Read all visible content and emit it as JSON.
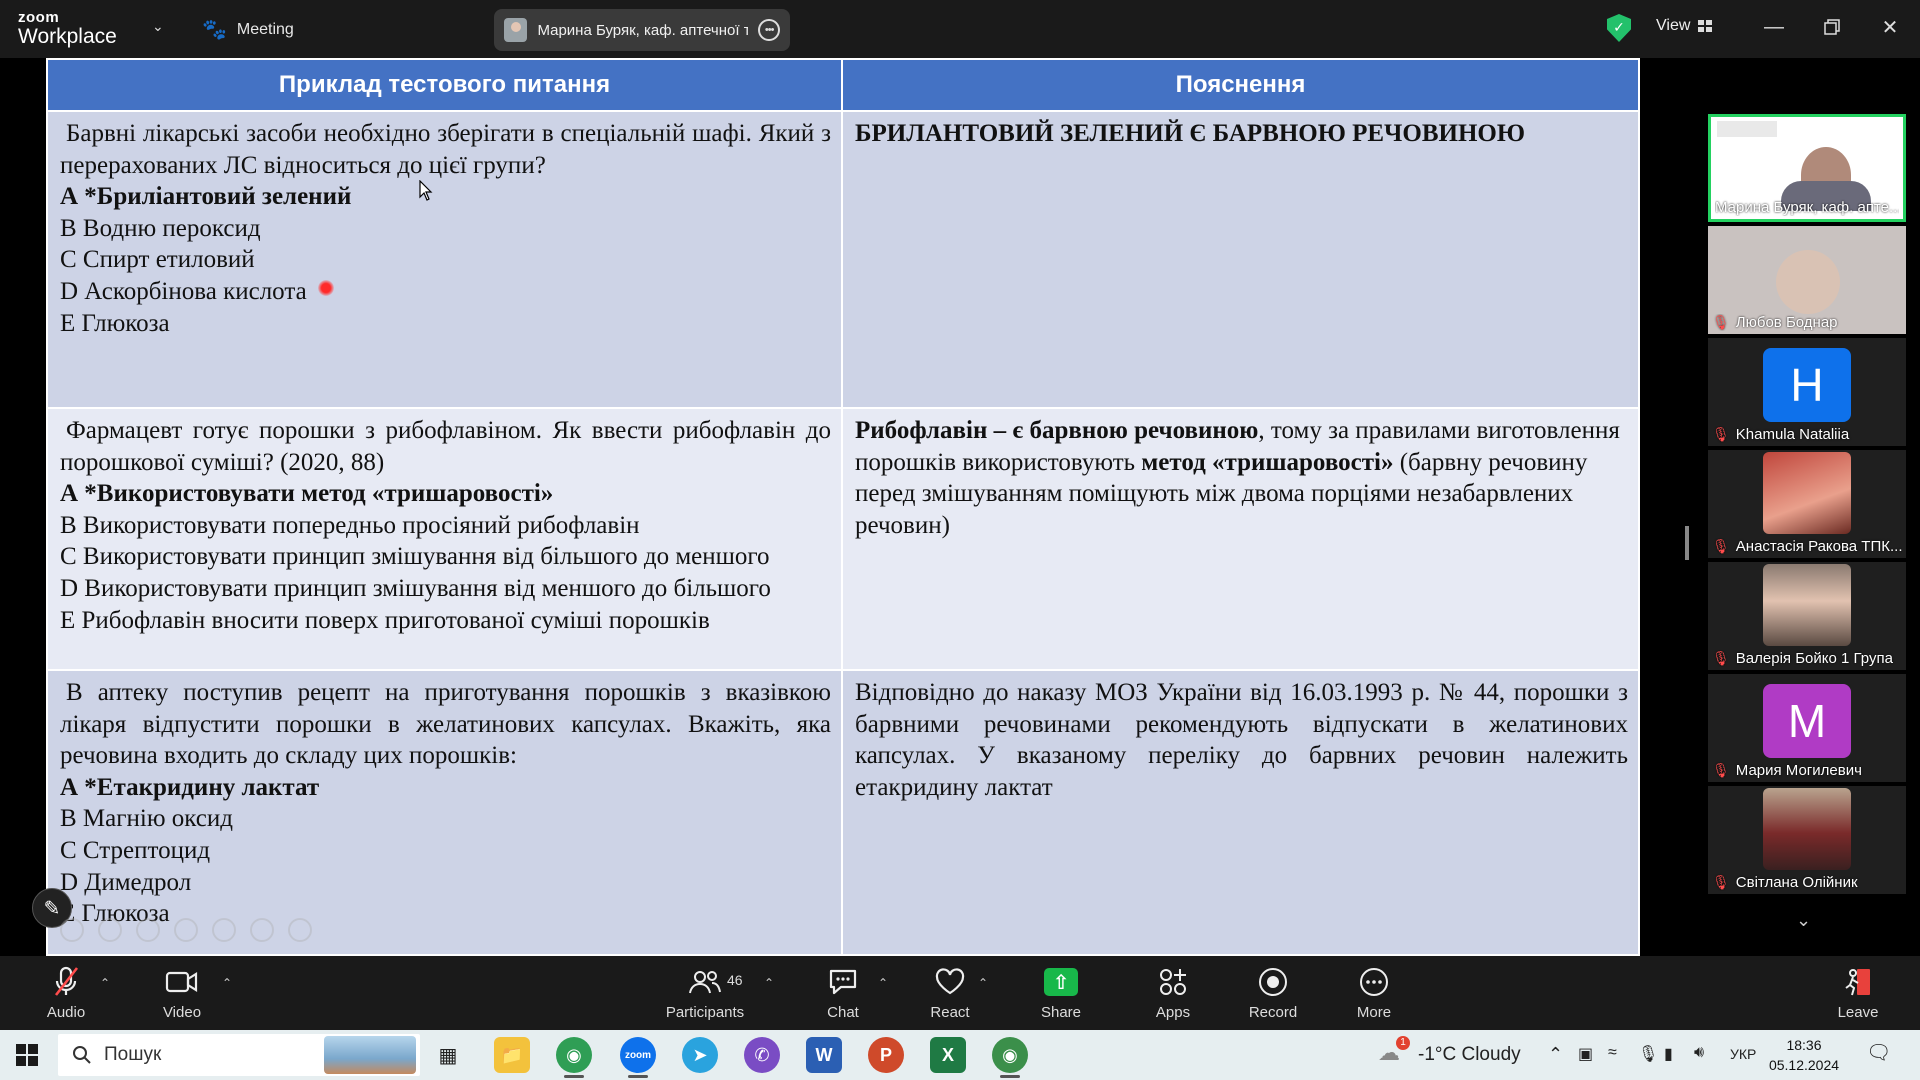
{
  "titlebar": {
    "brand_top": "zoom",
    "brand_bottom": "Workplace",
    "meeting_label": "Meeting",
    "host_name": "Марина Буряк, каф. аптечної те",
    "view_label": "View"
  },
  "slide": {
    "headers": [
      "Приклад тестового питання",
      "Пояснення"
    ],
    "rows": [
      {
        "question": "Барвні лікарські засоби необхідно зберігати в спеціальній шафі. Який з перерахованих ЛС відноситься до цієї групи?",
        "answer": "А *Бриліантовий зелений",
        "options": [
          "В  Водню пероксид",
          "С  Спирт етиловий",
          "D  Аскорбінова кислота",
          "Е  Глюкоза"
        ],
        "explanation_bold": "БРИЛАНТОВИЙ ЗЕЛЕНИЙ Є БАРВНОЮ РЕЧОВИНОЮ"
      },
      {
        "question": "Фармацевт готує порошки з рибофлавіном. Як ввести рибофлавін до порошкової суміші? (2020, 88)",
        "answer": "А *Використовувати  метод «тришаровості»",
        "options": [
          "В  Використовувати попередньо просіяний рибофлавін",
          "С  Використовувати принцип змішування від більшого до меншого",
          "D  Використовувати принцип змішування від меншого до більшого",
          "Е  Рибофлавін вносити поверх приготованої суміші порошків"
        ],
        "explanation_b1": "Рибофлавін – є барвною речовиною",
        "explanation_t1": ", тому за правилами виготовлення порошків використовують ",
        "explanation_b2": "метод «тришаровості»",
        "explanation_t2": " (барвну речовину перед змішуванням поміщують між двома порціями незабарвлених речовин)"
      },
      {
        "question": "В аптеку поступив рецепт на приготування порошків з вказівкою лікаря відпустити порошки в желатинових капсулах. Вкажіть, яка речовина  входить до складу цих порошків:",
        "answer": "А *Етакридину лактат",
        "options": [
          "В  Магнію оксид",
          "С  Стрептоцид",
          "D  Димедрол",
          "Е  Глюкоза"
        ],
        "explanation": "Відповідно до наказу МОЗ України від 16.03.1993 р. № 44, порошки з барвними речовинами рекомендують відпускати в желатинових капсулах. У вказаному переліку до барвних речовин належить етакридину лактат"
      }
    ]
  },
  "gallery": {
    "tiles": [
      {
        "name": "Марина Буряк, каф. апте...",
        "kind": "slide",
        "muted": false
      },
      {
        "name": "Любов Боднар",
        "kind": "photo",
        "muted": true
      },
      {
        "name": "Khamula Nataliia",
        "kind": "letter",
        "letter": "H",
        "color": "#0e71eb",
        "muted": true
      },
      {
        "name": "Анастасія Ракова ТПК...",
        "kind": "photo",
        "muted": true
      },
      {
        "name": "Валерія Бойко 1 Група",
        "kind": "photo",
        "muted": true
      },
      {
        "name": "Мария Могилевич",
        "kind": "letter",
        "letter": "M",
        "color": "#b03bc5",
        "muted": true
      },
      {
        "name": "Світлана Олійник",
        "kind": "photo",
        "muted": true
      }
    ]
  },
  "toolbar": {
    "audio": "Audio",
    "video": "Video",
    "participants": "Participants",
    "participants_count": "46",
    "chat": "Chat",
    "react": "React",
    "share": "Share",
    "apps": "Apps",
    "record": "Record",
    "more": "More",
    "leave": "Leave"
  },
  "taskbar": {
    "search_placeholder": "Пошук",
    "weather_badge": "1",
    "weather": "-1°C  Cloudy",
    "lang": "УКР",
    "time": "18:36",
    "date": "05.12.2024"
  },
  "colors": {
    "slide_header": "#4472c4",
    "row_dark": "#cdd3e6",
    "row_light": "#e7eaf4",
    "active_speaker": "#23d160",
    "share_green": "#18b84a"
  }
}
